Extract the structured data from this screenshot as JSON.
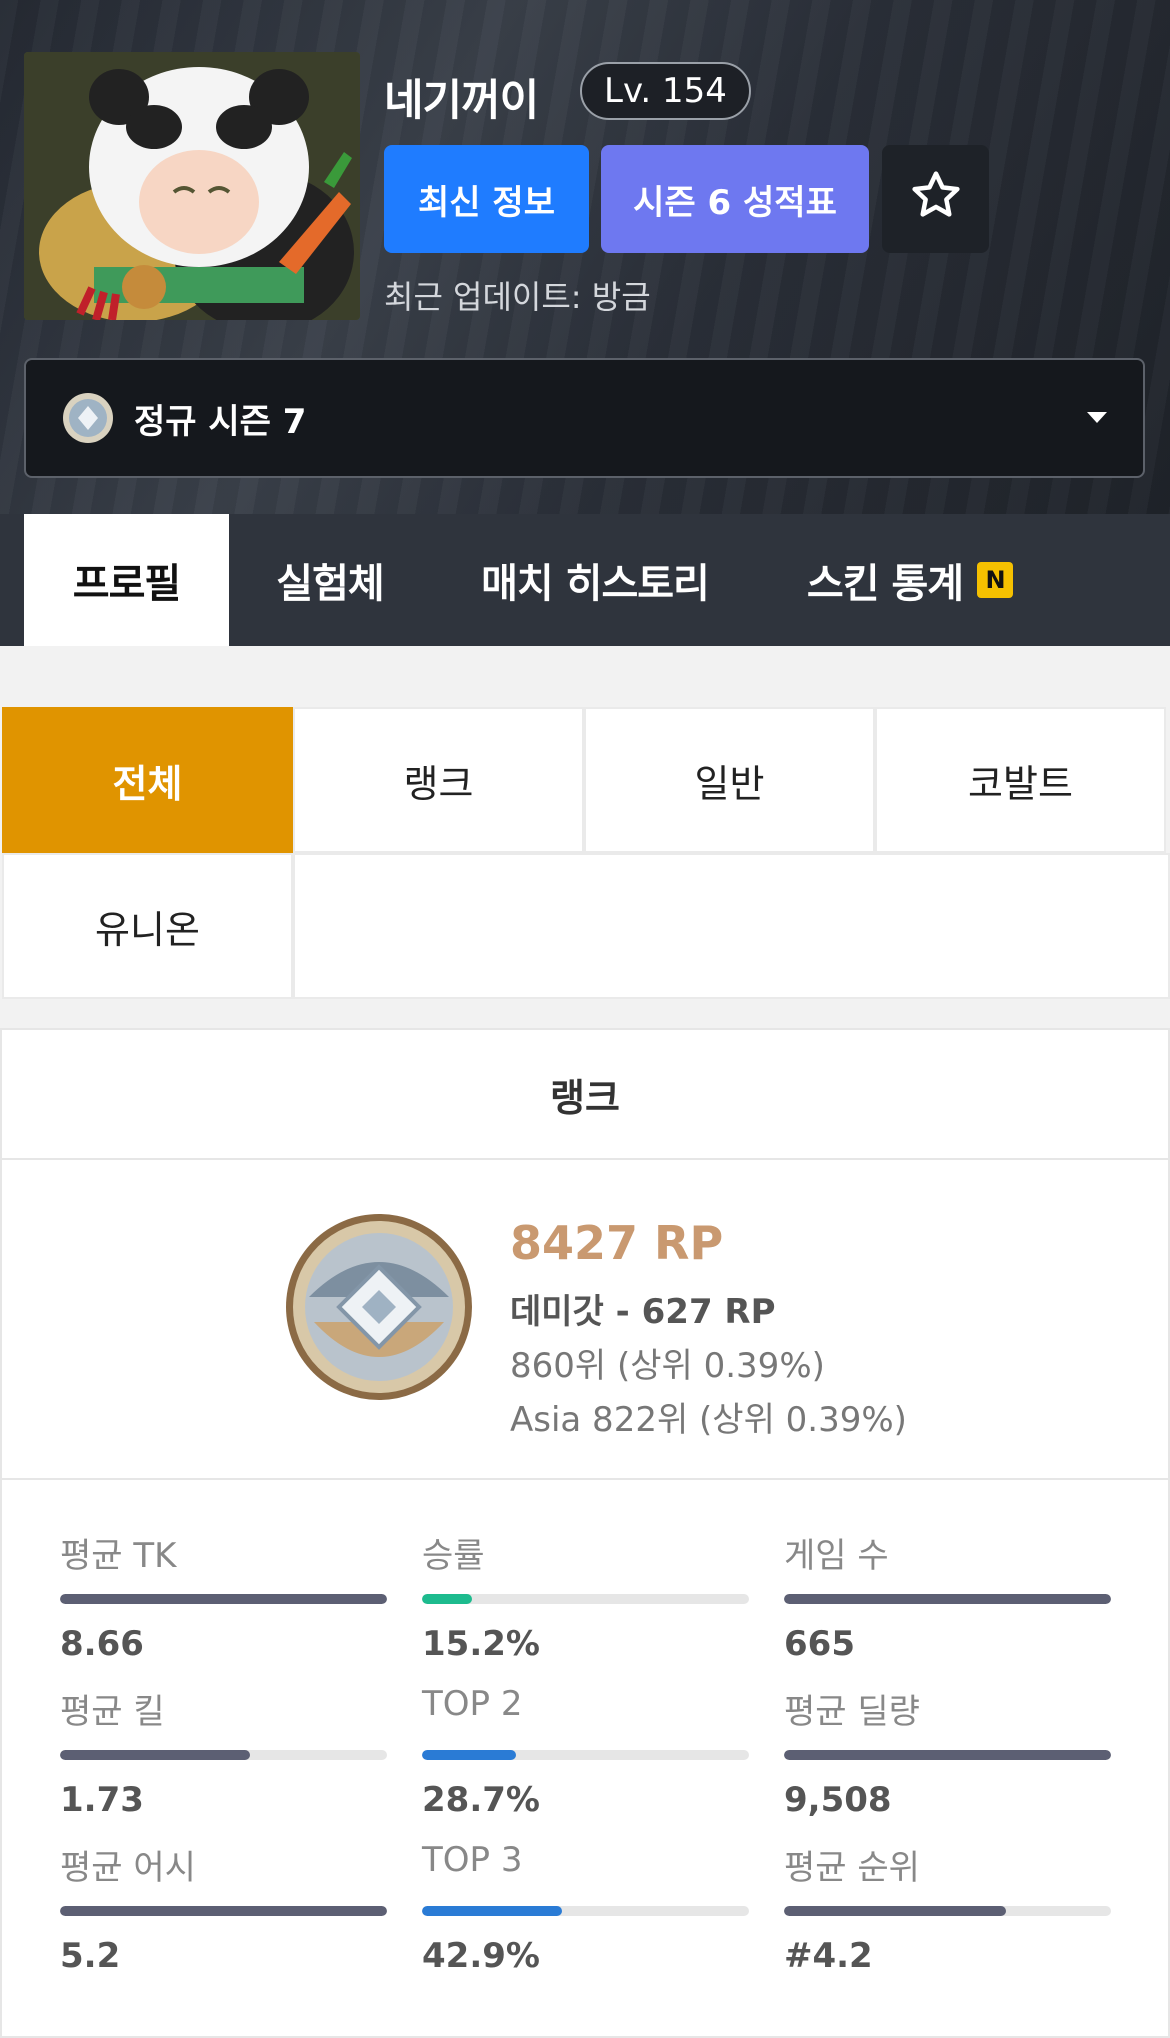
{
  "player": {
    "nickname": "네기꺼이",
    "level": "Lv. 154",
    "updated": "최근 업데이트: 방금"
  },
  "actions": {
    "latest": "최신 정보",
    "season6": "시즌 6 성적표"
  },
  "season_select": {
    "label": "정규 시즌 7"
  },
  "tabs": [
    {
      "label": "프로필",
      "active": true
    },
    {
      "label": "실험체"
    },
    {
      "label": "매치 히스토리"
    },
    {
      "label": "스킨 통계",
      "badge": "N"
    }
  ],
  "modes": [
    "전체",
    "랭크",
    "일반",
    "코발트",
    "유니온"
  ],
  "rank": {
    "title": "랭크",
    "rp": "8427 RP",
    "tier": "데미갓 - 627 RP",
    "ranking": "860위 (상위 0.39%)",
    "asia": "Asia 822위 (상위 0.39%)"
  },
  "stats": [
    {
      "label": "평균 TK",
      "value": "8.66",
      "fill": 1.0,
      "color": "#5c5f73"
    },
    {
      "label": "승률",
      "value": "15.2%",
      "fill": 0.152,
      "color": "#1dbb8e"
    },
    {
      "label": "게임 수",
      "value": "665",
      "fill": 1.0,
      "color": "#5c5f73"
    },
    {
      "label": "평균 킬",
      "value": "1.73",
      "fill": 0.58,
      "color": "#5c5f73"
    },
    {
      "label": "TOP 2",
      "value": "28.7%",
      "fill": 0.287,
      "color": "#2a7bd5"
    },
    {
      "label": "평균 딜량",
      "value": "9,508",
      "fill": 1.0,
      "color": "#5c5f73"
    },
    {
      "label": "평균 어시",
      "value": "5.2",
      "fill": 1.0,
      "color": "#5c5f73"
    },
    {
      "label": "TOP 3",
      "value": "42.9%",
      "fill": 0.429,
      "color": "#2a7bd5"
    },
    {
      "label": "평균 순위",
      "value": "#4.2",
      "fill": 0.68,
      "color": "#5c5f73"
    }
  ]
}
